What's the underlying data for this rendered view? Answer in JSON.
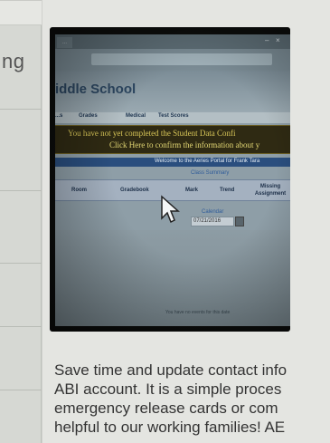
{
  "sidebar": {
    "fragment_text": "ng"
  },
  "photo": {
    "browser_tab": "..."
  },
  "portal": {
    "school_title": "iddle School",
    "nav": [
      "...s",
      "Grades",
      "Medical",
      "Test Scores"
    ],
    "alert_line1": "You have not yet completed the Student Data Confi",
    "alert_line2": "Click Here to confirm the information about y",
    "welcome": "Welcome to the Aeries Portal for Frank Tara",
    "summary_title": "Class Summary",
    "columns": [
      "Room",
      "Gradebook",
      "Mark",
      "Trend",
      "Missing Assignment"
    ],
    "calendar_label": "Calendar",
    "date_value": "07/21/2016",
    "no_events": "You have no events for this date"
  },
  "article": {
    "lines": [
      "Save time and update contact info",
      "ABI account. It is a simple proces",
      "emergency release cards or com",
      "helpful to our working families! AE"
    ]
  },
  "colors": {
    "alert_text": "#d9c758",
    "welcome_bar": "#2a4e7e",
    "school_title": "#2c4660"
  }
}
